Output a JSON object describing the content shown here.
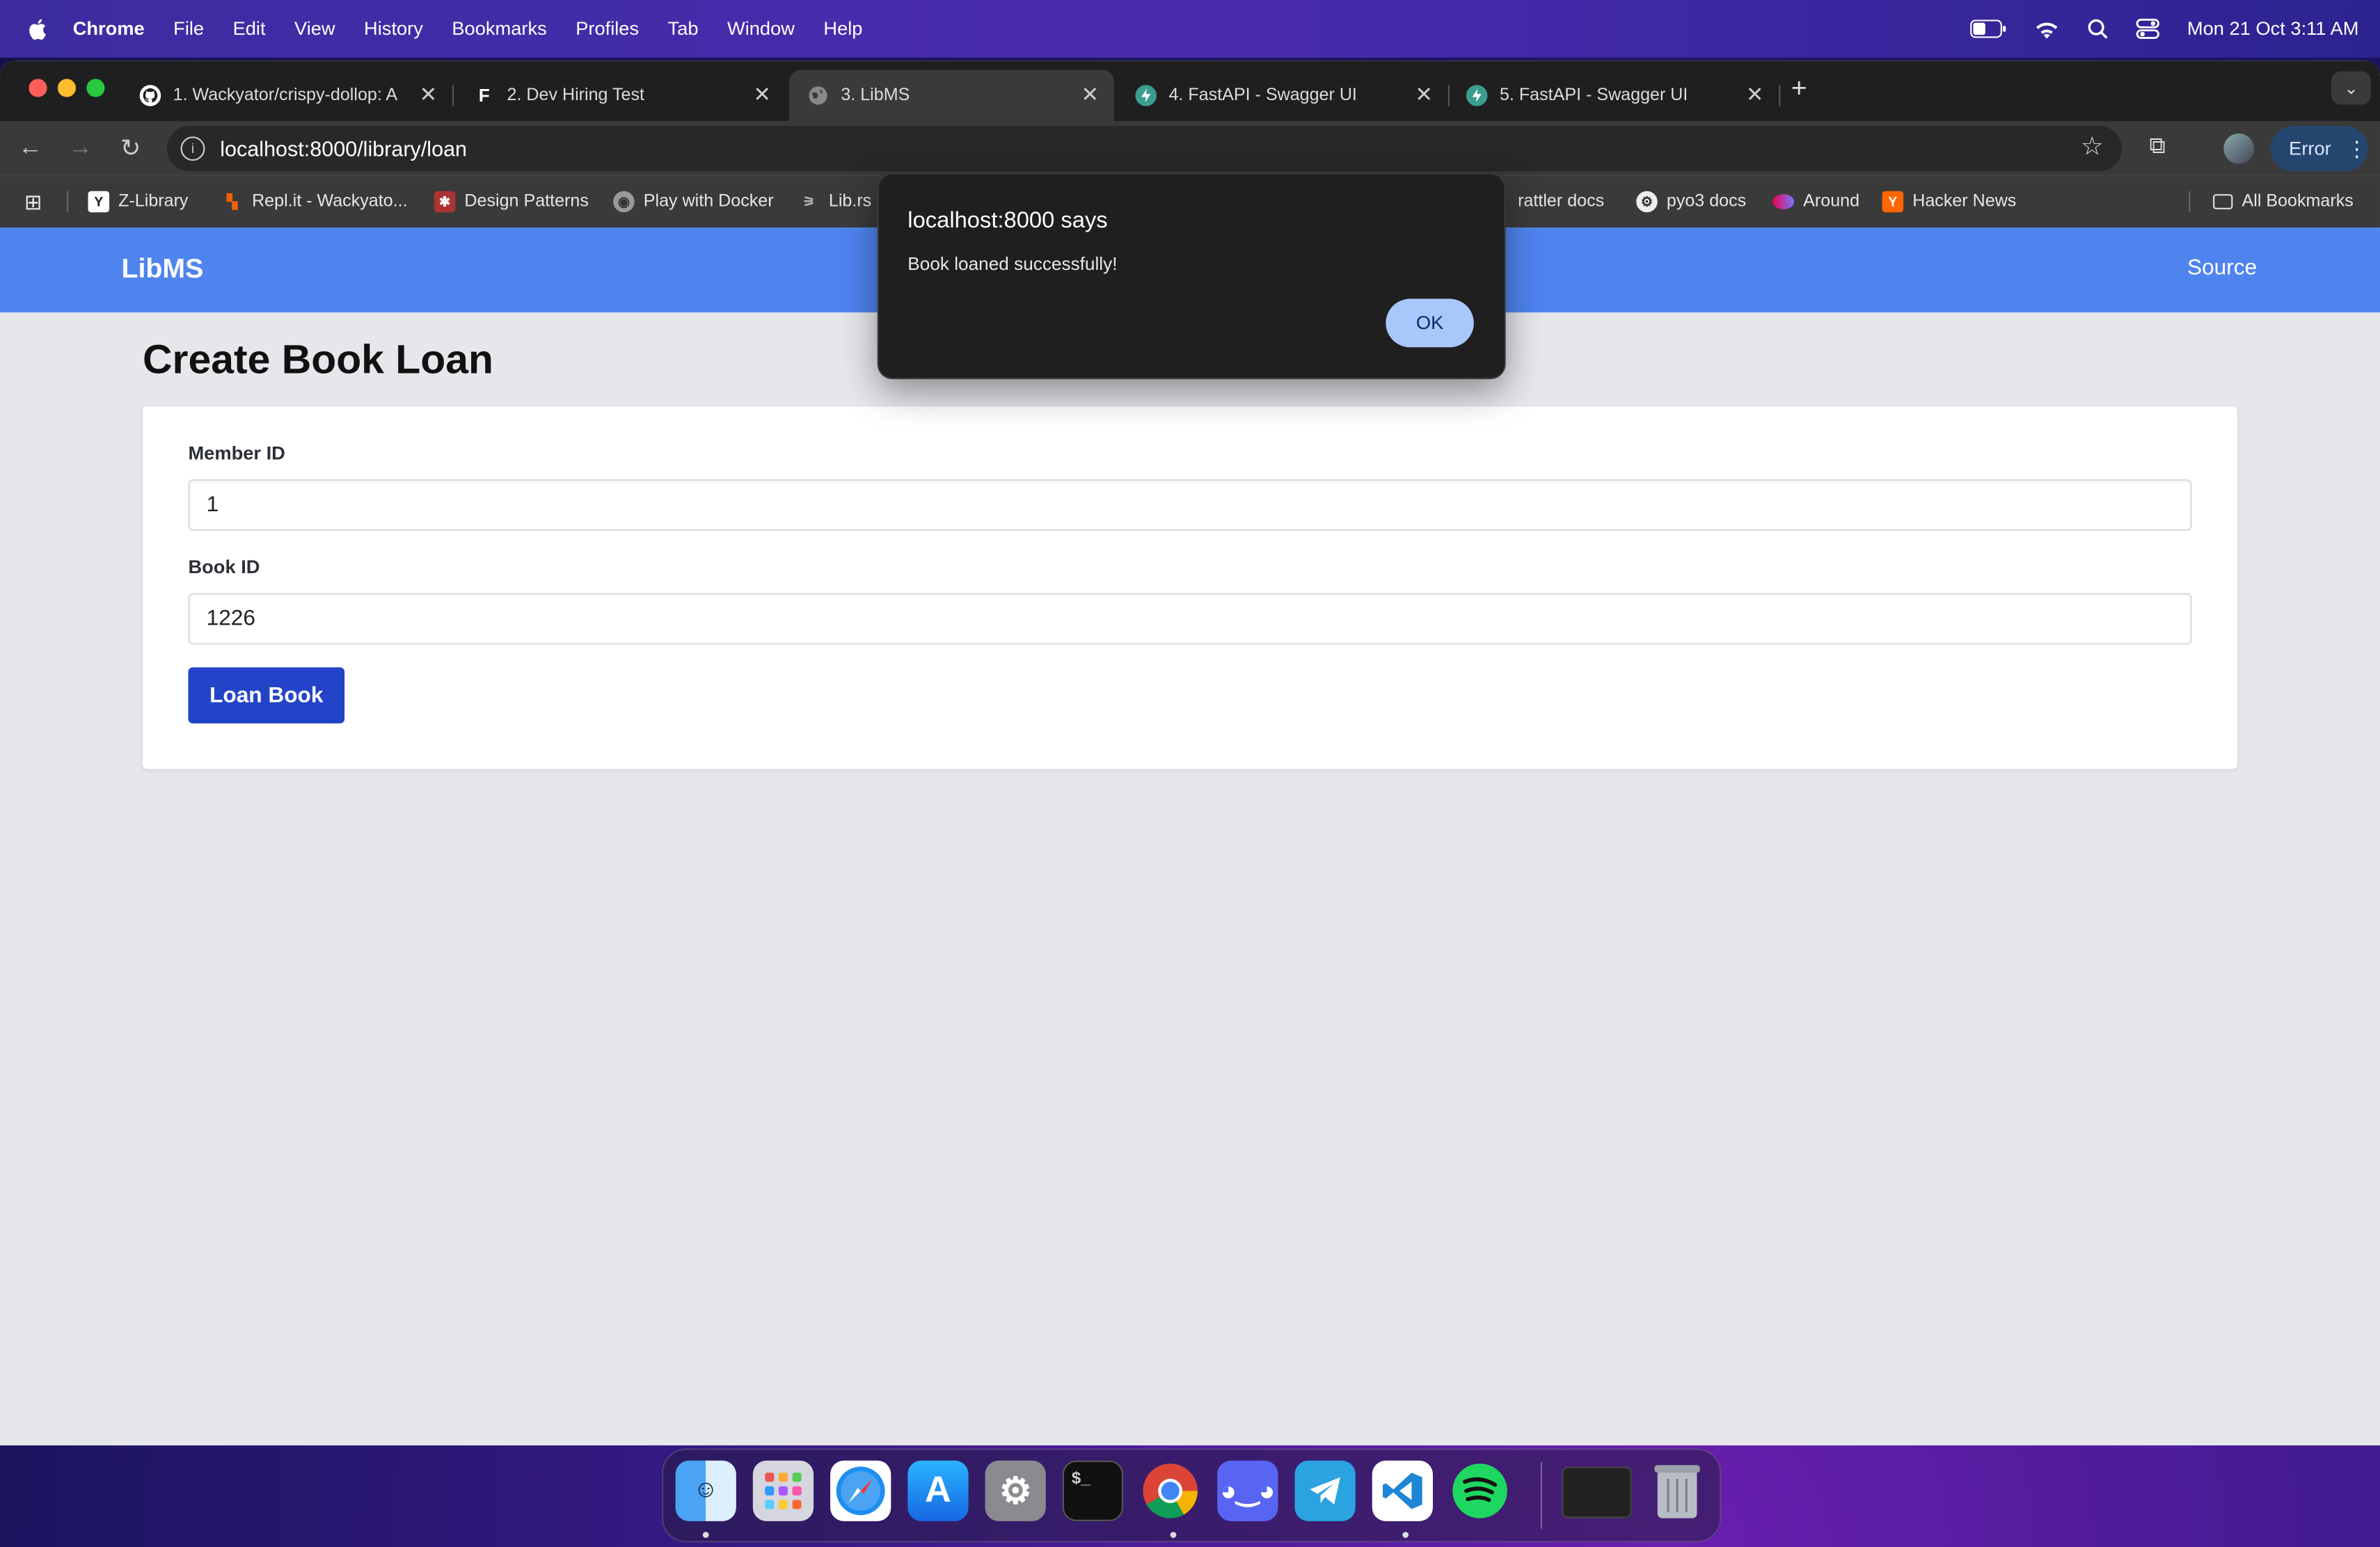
{
  "menubar": {
    "app": "Chrome",
    "items": [
      "File",
      "Edit",
      "View",
      "History",
      "Bookmarks",
      "Profiles",
      "Tab",
      "Window",
      "Help"
    ],
    "datetime": "Mon 21 Oct  3:11 AM"
  },
  "tabs": [
    {
      "label": "1. Wackyator/crispy-dollop: A",
      "icon": "github-icon"
    },
    {
      "label": "2. Dev Hiring Test",
      "icon": "form-icon"
    },
    {
      "label": "3. LibMS",
      "icon": "globe-icon"
    },
    {
      "label": "4. FastAPI - Swagger UI",
      "icon": "fastapi-icon"
    },
    {
      "label": "5. FastAPI - Swagger UI",
      "icon": "fastapi-icon"
    }
  ],
  "address": {
    "url": "localhost:8000/library/loan"
  },
  "profile_button": {
    "label": "Error"
  },
  "bookmarks": {
    "items": [
      "Z-Library",
      "Repl.it - Wackyato...",
      "Design Patterns",
      "Play with Docker",
      "Lib.rs",
      "rattler docs",
      "pyo3 docs",
      "Around",
      "Hacker News"
    ],
    "all": "All Bookmarks"
  },
  "app": {
    "brand": "LibMS",
    "nav_source": "Source",
    "page_title": "Create Book Loan",
    "form": {
      "member_label": "Member ID",
      "member_value": "1",
      "book_label": "Book ID",
      "book_value": "1226",
      "submit_label": "Loan Book"
    }
  },
  "dialog": {
    "title": "localhost:8000 says",
    "message": "Book loaned successfully!",
    "ok_label": "OK"
  },
  "dock": [
    "Finder",
    "Launchpad",
    "Safari",
    "App Store",
    "System Settings",
    "Terminal",
    "Chrome",
    "Discord",
    "Telegram",
    "VS Code",
    "Spotify",
    "Terminal Window",
    "Trash"
  ]
}
